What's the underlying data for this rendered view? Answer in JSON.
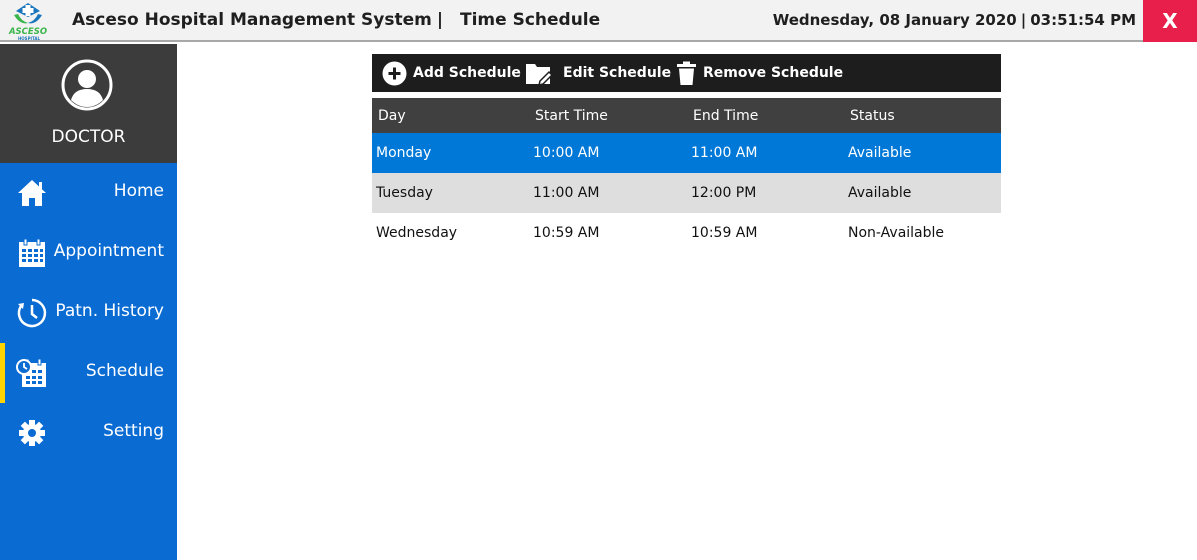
{
  "header": {
    "logo_text": "ASCESO",
    "logo_subtext": "HOSPITAL",
    "app_name": "Asceso Hospital Management System",
    "separator": "|",
    "page_title": "Time Schedule",
    "date": "Wednesday, 08 January 2020",
    "time": "03:51:54 PM",
    "close_label": "X",
    "close_color": "#e81e4b"
  },
  "sidebar": {
    "role": "DOCTOR",
    "accent_color": "#0a6bd3",
    "active_indicator_color": "#ffd400",
    "items": [
      {
        "label": "Home",
        "icon": "home-icon"
      },
      {
        "label": "Appointment",
        "icon": "calendar-icon"
      },
      {
        "label": "Patn. History",
        "icon": "clock-icon"
      },
      {
        "label": "Schedule",
        "icon": "schedule-icon",
        "active": true
      },
      {
        "label": "Setting",
        "icon": "gear-icon"
      }
    ]
  },
  "toolbar": {
    "add_label": "Add Schedule",
    "edit_label": "Edit Schedule",
    "remove_label": "Remove Schedule"
  },
  "table": {
    "columns": [
      "Day",
      "Start Time",
      "End Time",
      "Status"
    ],
    "selected_row_color": "#0078d7",
    "rows": [
      {
        "day": "Monday",
        "start": "10:00 AM",
        "end": "11:00 AM",
        "status": "Available"
      },
      {
        "day": "Tuesday",
        "start": "11:00 AM",
        "end": "12:00 PM",
        "status": "Available"
      },
      {
        "day": "Wednesday",
        "start": "10:59 AM",
        "end": "10:59 AM",
        "status": "Non-Available"
      }
    ]
  }
}
